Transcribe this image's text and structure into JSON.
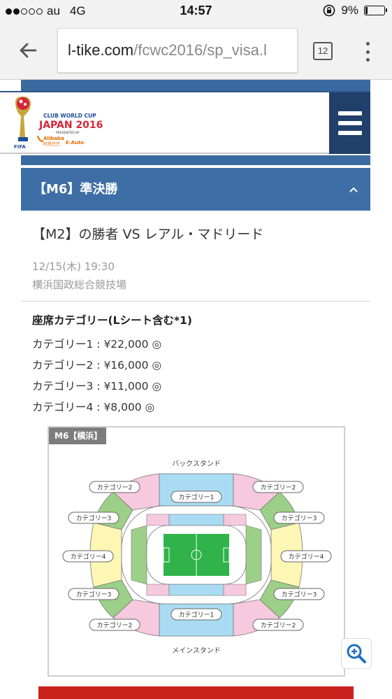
{
  "status_bar": {
    "carrier": "au",
    "network": "4G",
    "time": "14:57",
    "battery_pct": "9%"
  },
  "browser": {
    "url_host": "l-tike.com",
    "url_path": "/fcwc2016/sp_visa.l",
    "tab_count": "12",
    "back_icon": "back-arrow-icon",
    "menu_icon": "more-vert-icon"
  },
  "site": {
    "logo": {
      "line1": "CLUB WORLD CUP",
      "line2": "JAPAN 2016",
      "line3": "PRESENTED BY",
      "sponsor_a": "Alibaba",
      "sponsor_b": "阿里巴巴",
      "sponsor_c": "E-Auto",
      "fifa": "FIFA"
    },
    "menu_icon": "hamburger-icon"
  },
  "section": {
    "title": "【M6】準決勝",
    "toggle_icon": "chevron-up-icon"
  },
  "match": {
    "title": "【M2】の勝者 VS レアル・マドリード",
    "date": "12/15(木) 19:30",
    "venue": "横浜国政総合競技場"
  },
  "seats": {
    "title": "座席カテゴリー(Lシート含む*1)",
    "categories": [
      "カテゴリー1 : ¥22,000 ◎",
      "カテゴリー2 : ¥16,000 ◎",
      "カテゴリー3 : ¥11,000 ◎",
      "カテゴリー4 : ¥8,000 ◎"
    ]
  },
  "seat_map": {
    "tag": "M6【横浜】",
    "back_stand": "バックスタンド",
    "main_stand": "メインスタンド",
    "cat1": "カテゴリー1",
    "cat2": "カテゴリー2",
    "cat3": "カテゴリー3",
    "cat4": "カテゴリー4",
    "colors": {
      "cat1": "#a9dcf3",
      "cat2": "#f6c9df",
      "cat3": "#9ccf88",
      "cat4": "#fdf6b5",
      "field": "#2fb34a"
    }
  },
  "zoom_icon": "zoom-in-icon"
}
